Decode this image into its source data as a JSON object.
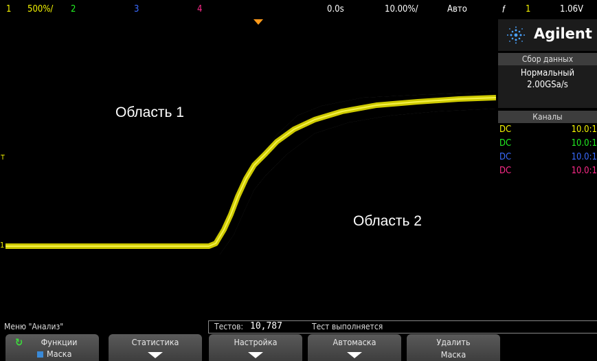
{
  "topbar": {
    "ch1_num": "1",
    "ch1_scale": "500%/",
    "ch2_num": "2",
    "ch3_num": "3",
    "ch4_num": "4",
    "time_delay": "0.0s",
    "time_scale": "10.00%/",
    "trigger_mode": "Авто",
    "trigger_ch": "1",
    "trigger_level": "1.06V"
  },
  "colors": {
    "ch1": "#f5f500",
    "ch2": "#22ee22",
    "ch3": "#3a6bff",
    "ch4": "#ff2a8a",
    "trace": "#e0dc00"
  },
  "display": {
    "area1": "Область 1",
    "area2": "Область 2"
  },
  "side": {
    "brand": "Agilent",
    "acq_title": "Сбор данных",
    "acq_mode": "Нормальный",
    "acq_rate": "2.00GSa/s",
    "channels_title": "Каналы",
    "channels": [
      {
        "coupling": "DC",
        "scale": "10.0:1"
      },
      {
        "coupling": "DC",
        "scale": "10.0:1"
      },
      {
        "coupling": "DC",
        "scale": "10.0:1"
      },
      {
        "coupling": "DC",
        "scale": "10.0:1"
      }
    ]
  },
  "status": {
    "menu_title": "Меню \"Анализ\"",
    "tests_label": "Тестов:",
    "tests_value": "10,787",
    "test_state": "Тест выполняется"
  },
  "softkeys": [
    {
      "line1": "Функции",
      "line2": "Маска"
    },
    {
      "line1": "Статистика"
    },
    {
      "line1": "Настройка"
    },
    {
      "line1": "Автомаска"
    },
    {
      "line1": "Удалить",
      "line2": "Маска"
    }
  ],
  "markers": {
    "ground": "1",
    "trigger": "T"
  }
}
